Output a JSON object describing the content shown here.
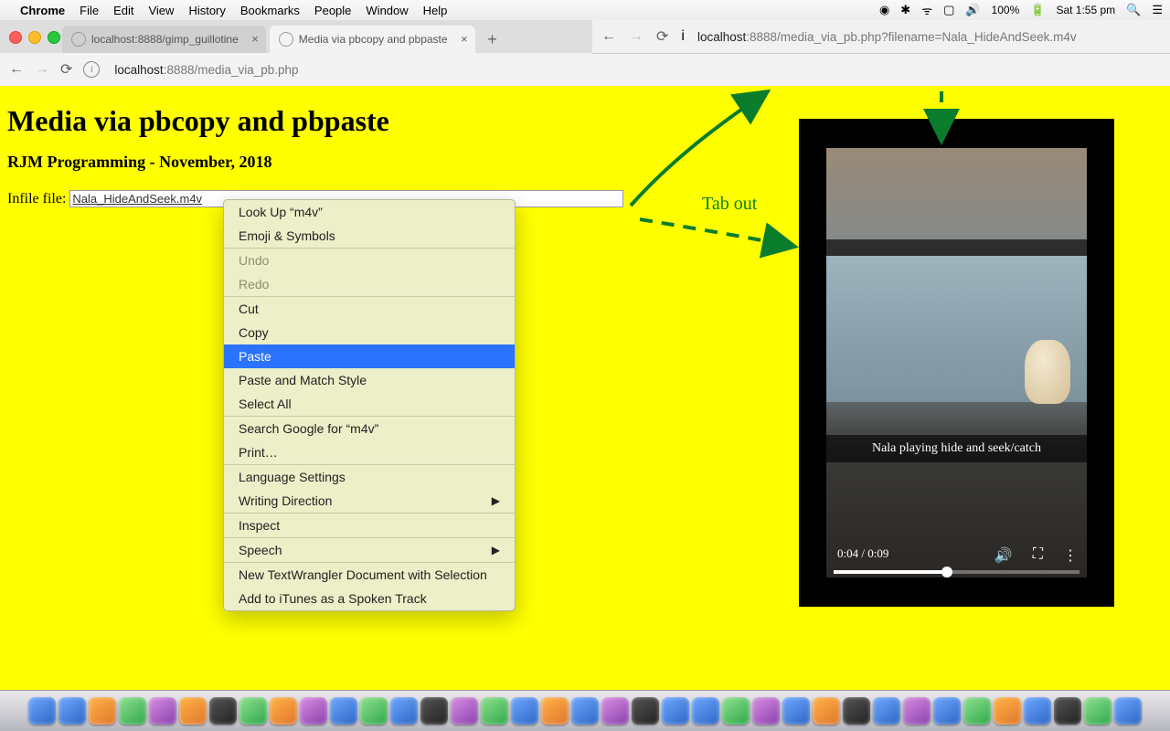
{
  "menubar": {
    "app": "Chrome",
    "items": [
      "File",
      "Edit",
      "View",
      "History",
      "Bookmarks",
      "People",
      "Window",
      "Help"
    ],
    "battery": "100%",
    "clock": "Sat 1:55 pm"
  },
  "tabs": [
    {
      "title": "localhost:8888/gimp_guillotine"
    },
    {
      "title": "Media via pbcopy and pbpaste"
    }
  ],
  "addr1": {
    "host": "localhost",
    "rest": ":8888/media_via_pb.php"
  },
  "addr2": {
    "host": "localhost",
    "rest": ":8888/media_via_pb.php?filename=Nala_HideAndSeek.m4v"
  },
  "page": {
    "h1": "Media via pbcopy and pbpaste",
    "h2": "RJM Programming - November, 2018",
    "label": "Infile file:",
    "input_value": "Nala_HideAndSeek.m4v"
  },
  "context_menu": {
    "lookup": "Look Up “m4v”",
    "emoji": "Emoji & Symbols",
    "undo": "Undo",
    "redo": "Redo",
    "cut": "Cut",
    "copy": "Copy",
    "paste": "Paste",
    "paste_match": "Paste and Match Style",
    "select_all": "Select All",
    "search": "Search Google for “m4v”",
    "print": "Print…",
    "lang": "Language Settings",
    "writing": "Writing Direction",
    "inspect": "Inspect",
    "speech": "Speech",
    "textwrangler": "New TextWrangler Document with Selection",
    "itunes": "Add to iTunes as a Spoken Track"
  },
  "annotation": {
    "tab_out": "Tab out"
  },
  "video": {
    "caption": "Nala playing hide and seek/catch",
    "time": "0:04 / 0:09"
  }
}
